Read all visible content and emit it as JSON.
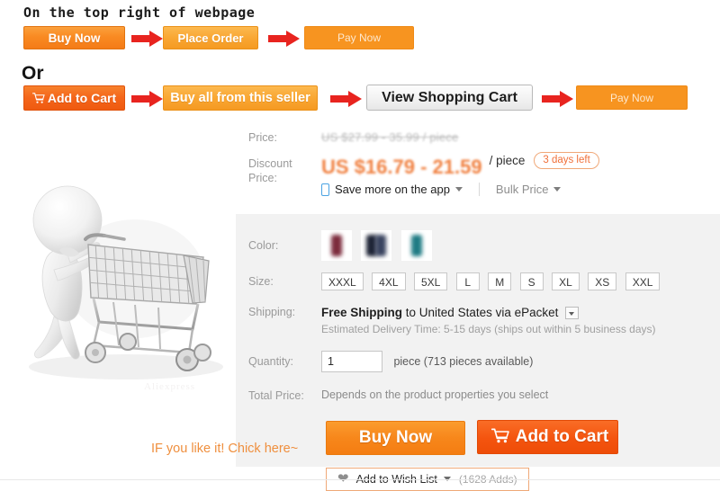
{
  "instructions": {
    "heading_top": "On the top right of webpage",
    "or_label": "Or",
    "flow_top": [
      {
        "label": "Buy Now",
        "style": "orange"
      },
      {
        "label": "Place Order",
        "style": "orange-lt"
      },
      {
        "label": "Pay Now",
        "style": "orange-flat"
      }
    ],
    "flow_bottom": [
      {
        "label": "Add to Cart",
        "style": "red",
        "icon": "cart-icon"
      },
      {
        "label": "Buy all from this seller",
        "style": "orange-lt"
      },
      {
        "label": "View Shopping Cart",
        "style": "gray"
      },
      {
        "label": "Pay Now",
        "style": "orange-flat"
      }
    ],
    "arrow_icon": "arrow-right-icon",
    "arrow_color": "#e8241f"
  },
  "product_image": {
    "alt": "3d-man-pushing-shopping-cart",
    "watermark": "Aliexpress"
  },
  "price": {
    "label": "Price:",
    "original": "US $27.99 - 35.99 / piece",
    "discount_label_line1": "Discount",
    "discount_label_line2": "Price:",
    "discount": "US $16.79 - 21.59",
    "unit": "/ piece",
    "promo_badge": "3 days left",
    "app_link": "Save more on the app",
    "bulk_link": "Bulk Price",
    "discount_color": "#f08040",
    "badge_color": "#f0703a"
  },
  "options": {
    "color": {
      "label": "Color:",
      "swatches": [
        {
          "name": "swatch-maroon",
          "colors": [
            "#7c2b3c"
          ]
        },
        {
          "name": "swatch-navy",
          "colors": [
            "#1e2436",
            "#303a55"
          ]
        },
        {
          "name": "swatch-teal",
          "colors": [
            "#1f7b84"
          ]
        }
      ]
    },
    "size": {
      "label": "Size:",
      "values": [
        "XXXL",
        "4XL",
        "5XL",
        "L",
        "M",
        "S",
        "XL",
        "XS",
        "XXL"
      ]
    },
    "shipping": {
      "label": "Shipping:",
      "free_text": "Free Shipping",
      "destination": "to United States via ePacket",
      "estimate": "Estimated Delivery Time: 5-15 days (ships out within 5 business days)"
    },
    "quantity": {
      "label": "Quantity:",
      "value": "1",
      "suffix": "piece (713 pieces available)"
    },
    "total_price": {
      "label": "Total Price:",
      "value": "Depends on the product properties you select"
    }
  },
  "actions": {
    "buy_now": "Buy Now",
    "add_to_cart": "Add to Cart",
    "cart_icon": "cart-icon",
    "wish": {
      "heart_icon": "heart-icon",
      "label": "Add to Wish List",
      "count": "(1628 Adds)"
    },
    "annotation": "IF you like it! Chick here~",
    "annotation_color": "#ef8f3e"
  }
}
